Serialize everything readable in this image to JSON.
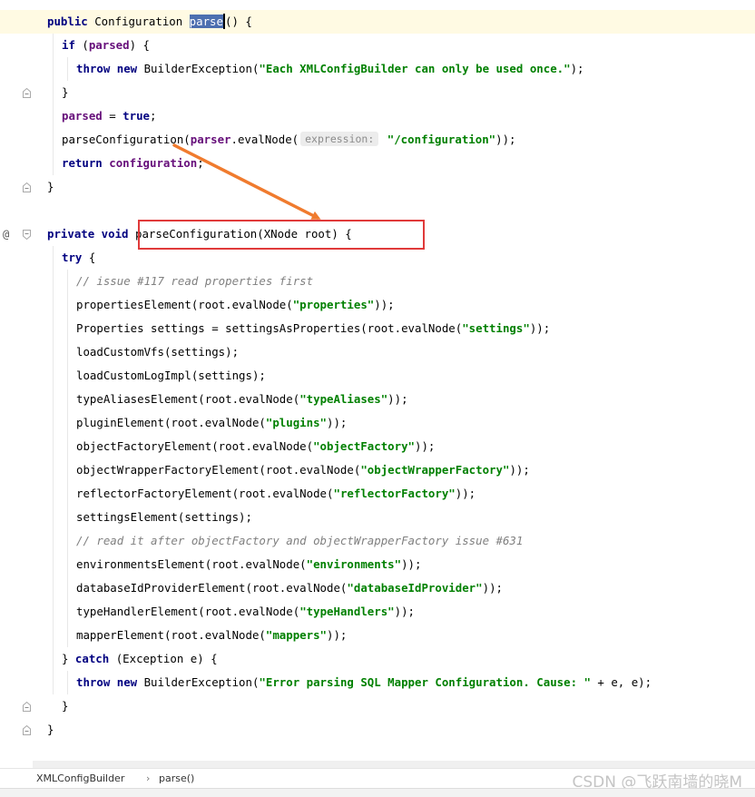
{
  "editor": {
    "lines": [
      {
        "segments": [
          {
            "t": "public",
            "c": "kw"
          },
          {
            "t": " Configuration "
          },
          {
            "t": "parse",
            "c": "hl"
          },
          {
            "t": "",
            "c": "caret"
          },
          {
            "t": "() {"
          }
        ]
      },
      {
        "segments": [
          {
            "t": "if",
            "c": "kw"
          },
          {
            "t": " ("
          },
          {
            "t": "parsed",
            "c": "fld"
          },
          {
            "t": ") {"
          }
        ]
      },
      {
        "segments": [
          {
            "t": "throw new",
            "c": "kw"
          },
          {
            "t": " BuilderException("
          },
          {
            "t": "\"Each XMLConfigBuilder can only be used once.\"",
            "c": "str"
          },
          {
            "t": ");"
          }
        ]
      },
      {
        "segments": [
          {
            "t": "}"
          }
        ]
      },
      {
        "segments": [
          {
            "t": "parsed",
            "c": "fld"
          },
          {
            "t": " = "
          },
          {
            "t": "true",
            "c": "kw"
          },
          {
            "t": ";"
          }
        ]
      },
      {
        "segments": [
          {
            "t": "parseConfiguration("
          },
          {
            "t": "parser",
            "c": "fld"
          },
          {
            "t": ".evalNode("
          },
          {
            "t": "expression:",
            "c": "hint"
          },
          {
            "t": " "
          },
          {
            "t": "\"/configuration\"",
            "c": "str"
          },
          {
            "t": "));"
          }
        ]
      },
      {
        "segments": [
          {
            "t": "return",
            "c": "kw"
          },
          {
            "t": " "
          },
          {
            "t": "configuration",
            "c": "fld"
          },
          {
            "t": ";"
          }
        ]
      },
      {
        "segments": [
          {
            "t": "}"
          }
        ]
      },
      {
        "segments": []
      },
      {
        "segments": [
          {
            "t": "private void",
            "c": "kw"
          },
          {
            "t": " parseConfiguration(XNode root) {"
          }
        ]
      },
      {
        "segments": [
          {
            "t": "try",
            "c": "kw"
          },
          {
            "t": " {"
          }
        ]
      },
      {
        "segments": [
          {
            "t": "// issue #117 read properties first",
            "c": "cmt"
          }
        ]
      },
      {
        "segments": [
          {
            "t": "propertiesElement(root.evalNode("
          },
          {
            "t": "\"properties\"",
            "c": "str"
          },
          {
            "t": "));"
          }
        ]
      },
      {
        "segments": [
          {
            "t": "Properties settings = settingsAsProperties(root.evalNode("
          },
          {
            "t": "\"settings\"",
            "c": "str"
          },
          {
            "t": "));"
          }
        ]
      },
      {
        "segments": [
          {
            "t": "loadCustomVfs(settings);"
          }
        ]
      },
      {
        "segments": [
          {
            "t": "loadCustomLogImpl(settings);"
          }
        ]
      },
      {
        "segments": [
          {
            "t": "typeAliasesElement(root.evalNode("
          },
          {
            "t": "\"typeAliases\"",
            "c": "str"
          },
          {
            "t": "));"
          }
        ]
      },
      {
        "segments": [
          {
            "t": "pluginElement(root.evalNode("
          },
          {
            "t": "\"plugins\"",
            "c": "str"
          },
          {
            "t": "));"
          }
        ]
      },
      {
        "segments": [
          {
            "t": "objectFactoryElement(root.evalNode("
          },
          {
            "t": "\"objectFactory\"",
            "c": "str"
          },
          {
            "t": "));"
          }
        ]
      },
      {
        "segments": [
          {
            "t": "objectWrapperFactoryElement(root.evalNode("
          },
          {
            "t": "\"objectWrapperFactory\"",
            "c": "str"
          },
          {
            "t": "));"
          }
        ]
      },
      {
        "segments": [
          {
            "t": "reflectorFactoryElement(root.evalNode("
          },
          {
            "t": "\"reflectorFactory\"",
            "c": "str"
          },
          {
            "t": "));"
          }
        ]
      },
      {
        "segments": [
          {
            "t": "settingsElement(settings);"
          }
        ]
      },
      {
        "segments": [
          {
            "t": "// read it after objectFactory and objectWrapperFactory issue #631",
            "c": "cmt"
          }
        ]
      },
      {
        "segments": [
          {
            "t": "environmentsElement(root.evalNode("
          },
          {
            "t": "\"environments\"",
            "c": "str"
          },
          {
            "t": "));"
          }
        ]
      },
      {
        "segments": [
          {
            "t": "databaseIdProviderElement(root.evalNode("
          },
          {
            "t": "\"databaseIdProvider\"",
            "c": "str"
          },
          {
            "t": "));"
          }
        ]
      },
      {
        "segments": [
          {
            "t": "typeHandlerElement(root.evalNode("
          },
          {
            "t": "\"typeHandlers\"",
            "c": "str"
          },
          {
            "t": "));"
          }
        ]
      },
      {
        "segments": [
          {
            "t": "mapperElement(root.evalNode("
          },
          {
            "t": "\"mappers\"",
            "c": "str"
          },
          {
            "t": "));"
          }
        ]
      },
      {
        "segments": [
          {
            "t": "} "
          },
          {
            "t": "catch",
            "c": "kw"
          },
          {
            "t": " (Exception e) {"
          }
        ]
      },
      {
        "segments": [
          {
            "t": "throw new",
            "c": "kw"
          },
          {
            "t": " BuilderException("
          },
          {
            "t": "\"Error parsing SQL Mapper Configuration. Cause: \"",
            "c": "str"
          },
          {
            "t": " + e, e);"
          }
        ]
      },
      {
        "segments": [
          {
            "t": "}"
          }
        ]
      },
      {
        "segments": [
          {
            "t": "}"
          }
        ]
      }
    ],
    "gutter_marks": [
      {
        "line": 9,
        "text": "@"
      }
    ],
    "colors": {
      "keyword": "#000080",
      "string": "#008000",
      "field": "#660e7a",
      "comment": "#808080",
      "selection": "#4c6fb0",
      "caret_line": "#fffae3",
      "annotation_box": "#e03a3a",
      "arrow": "#f07b2e"
    }
  },
  "breadcrumb": {
    "items": [
      "XMLConfigBuilder",
      "parse()"
    ],
    "separator": "›"
  },
  "watermark": "CSDN @飞跃南墙的晓M"
}
